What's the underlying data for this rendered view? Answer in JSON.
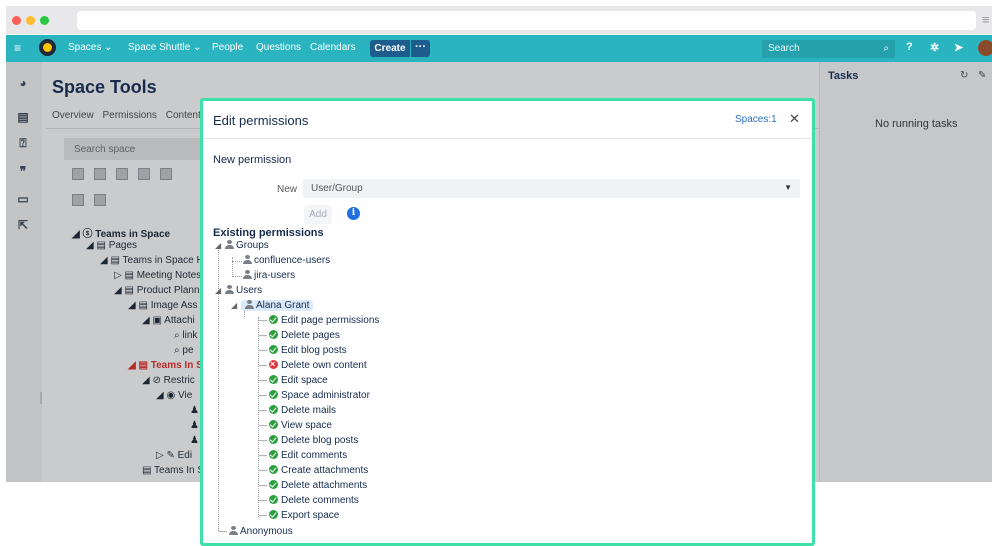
{
  "topnav": {
    "items": [
      "Spaces ⌄",
      "Space Shuttle ⌄",
      "People",
      "Questions",
      "Calendars"
    ],
    "create_label": "Create",
    "more_label": "···",
    "search_placeholder": "Search"
  },
  "background": {
    "space_title": "Space Tools",
    "tabs": [
      "Overview",
      "Permissions",
      "Content"
    ],
    "search_placeholder": "Search space",
    "tree": [
      {
        "label": "Teams in Space",
        "style": "bold"
      },
      {
        "label": "Pages",
        "style": ""
      },
      {
        "label": "Teams in Space H",
        "style": ""
      },
      {
        "label": "Meeting Notes",
        "style": ""
      },
      {
        "label": "Product Plann",
        "style": ""
      },
      {
        "label": "Image Ass",
        "style": ""
      },
      {
        "label": "Attachi",
        "style": ""
      },
      {
        "label": "link",
        "style": ""
      },
      {
        "label": "pe",
        "style": ""
      },
      {
        "label": "Teams In S",
        "style": "red"
      },
      {
        "label": "Restric",
        "style": ""
      },
      {
        "label": "Vie",
        "style": ""
      },
      {
        "label": "Edi",
        "style": ""
      },
      {
        "label": "Teams In S",
        "style": ""
      }
    ],
    "tasks_title": "Tasks",
    "tasks_message": "No running tasks"
  },
  "modal": {
    "title": "Edit permissions",
    "spaces_link": "Spaces:1",
    "close": "✕",
    "new_permission_heading": "New permission",
    "new_label": "New",
    "select_value": "User/Group",
    "add_label": "Add",
    "info_label": "i",
    "existing_heading": "Existing permissions",
    "groups_label": "Groups",
    "groups": [
      "confluence-users",
      "jira-users"
    ],
    "users_label": "Users",
    "user_name": "Alana Grant",
    "permissions": [
      {
        "label": "Edit page permissions",
        "status": "ok"
      },
      {
        "label": "Delete pages",
        "status": "ok"
      },
      {
        "label": "Edit blog posts",
        "status": "ok"
      },
      {
        "label": "Delete own content",
        "status": "no"
      },
      {
        "label": "Edit space",
        "status": "ok"
      },
      {
        "label": "Space administrator",
        "status": "ok"
      },
      {
        "label": "Delete mails",
        "status": "ok"
      },
      {
        "label": "View space",
        "status": "ok"
      },
      {
        "label": "Delete blog posts",
        "status": "ok"
      },
      {
        "label": "Edit comments",
        "status": "ok"
      },
      {
        "label": "Create attachments",
        "status": "ok"
      },
      {
        "label": "Delete attachments",
        "status": "ok"
      },
      {
        "label": "Delete comments",
        "status": "ok"
      },
      {
        "label": "Export space",
        "status": "ok"
      }
    ],
    "anonymous_label": "Anonymous"
  },
  "colors": {
    "nav": "#2ab4c0",
    "modal_border": "#3fe0a8",
    "granted": "#2a9f3c",
    "denied": "#e0363e",
    "link": "#2b6fc2"
  }
}
